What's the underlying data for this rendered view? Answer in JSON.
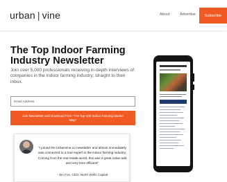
{
  "header": {
    "logo_left": "urban",
    "logo_separator": "|",
    "logo_right": "vine",
    "nav": {
      "about": "About",
      "advertise": "Advertise",
      "subscribe": "Subscribe"
    }
  },
  "hero": {
    "headline": "The Top Indoor Farming Industry Newsletter",
    "subcopy": "Join over 5,000 professionals receiving in-depth interviews of companies in the indoor farming industry, straight to their inbox.",
    "email_placeholder": "Email Address",
    "cta_label": "Join Newsletter and Download Free \"The Top 100 Indoor Farming Market Map\""
  },
  "testimonial": {
    "quote": "\"I joined the Urbanvine.co newsletter and almost immediately was connected to a true expert in the indoor farming industry. Coming from the real estate world, this was a great value add and very time efficient\"",
    "attribution": "- Jim Fox, CEO, North Wells Capital"
  },
  "phone_mockup": {
    "icon": "phone-mockup-icon"
  },
  "colors": {
    "accent": "#f15a22",
    "text_dark": "#111111",
    "text_muted": "#555555"
  }
}
